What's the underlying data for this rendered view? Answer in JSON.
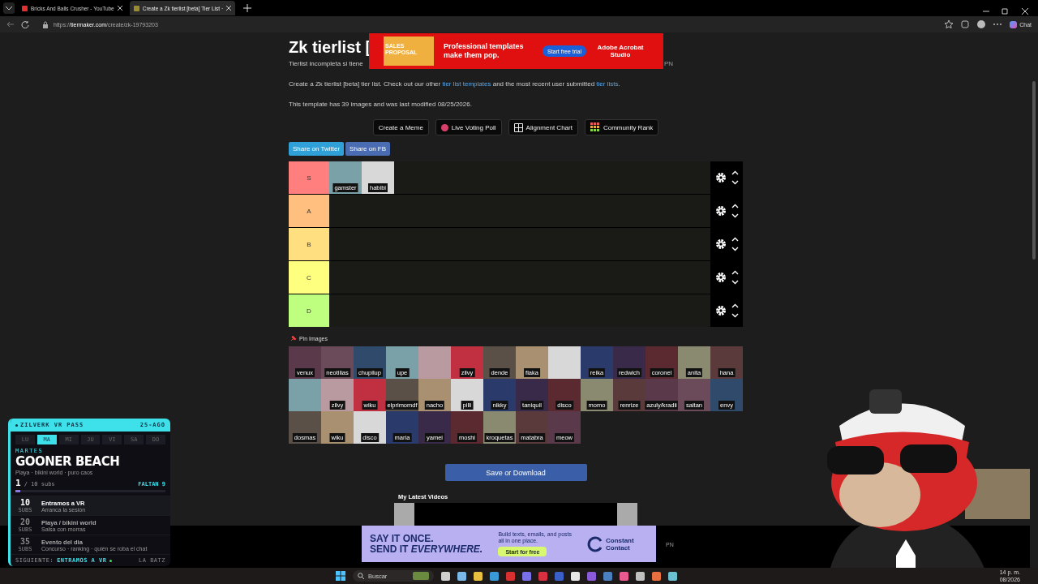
{
  "browser": {
    "tabs": [
      {
        "title": "Bricks And Balls Crusher - YouTube",
        "selected": false
      },
      {
        "title": "Create a Zk tierlist [beta] Tier List ·",
        "selected": true
      }
    ],
    "url": {
      "scheme": "https://",
      "host": "tiermaker.com",
      "path": "/create/zk-19793203"
    },
    "chat_label": "Chat"
  },
  "page": {
    "title": "Zk tierlist [",
    "description": "Tierlist incompleta si tiene",
    "side_text": "PN",
    "intro": [
      {
        "kind": "text",
        "text": "Create a Zk tierlist [beta] tier list. Check out our other "
      },
      {
        "kind": "link",
        "text": "tier list templates"
      },
      {
        "kind": "text",
        "text": " and the most recent user submitted "
      },
      {
        "kind": "link",
        "text": "tier lists"
      },
      {
        "kind": "text",
        "text": "."
      }
    ],
    "template_info": "This template has 39 images and was last modified 08/25/2026.",
    "tool_buttons": [
      {
        "label": "Create a Meme",
        "kind": "plain"
      },
      {
        "label": "Live Voting Poll",
        "kind": "dot"
      },
      {
        "label": "Alignment Chart",
        "kind": "grid"
      },
      {
        "label": "Community Rank",
        "kind": "mosaic"
      }
    ],
    "share_buttons": [
      {
        "label": "Share on Twitter",
        "color": "#2fa0d8"
      },
      {
        "label": "Share on FB",
        "color": "#4a6cb3"
      }
    ],
    "tiers": [
      {
        "label": "S",
        "color": "#ff7f7f",
        "items": [
          {
            "label": "gamster"
          },
          {
            "label": "habibi"
          }
        ]
      },
      {
        "label": "A",
        "color": "#ffbf7f"
      },
      {
        "label": "B",
        "color": "#ffdf7f"
      },
      {
        "label": "C",
        "color": "#ffff7f"
      },
      {
        "label": "D",
        "color": "#bfff7f"
      }
    ],
    "pin_label": "Pin Images",
    "images": [
      {
        "label": "venux"
      },
      {
        "label": "neotilias"
      },
      {
        "label": "chupilup"
      },
      {
        "label": "upe"
      },
      {
        "captioned": false
      },
      {
        "label": "zilvy"
      },
      {
        "label": "dende"
      },
      {
        "label": "flaka"
      },
      {
        "captioned": false
      },
      {
        "label": "reika"
      },
      {
        "label": "redwich"
      },
      {
        "label": "coronel"
      },
      {
        "label": "anita"
      },
      {
        "label": "hana"
      },
      {
        "captioned": false
      },
      {
        "label": "zilvy"
      },
      {
        "label": "wiku"
      },
      {
        "label": "elprimomdf"
      },
      {
        "label": "nacho"
      },
      {
        "label": "pilli"
      },
      {
        "label": "nikky"
      },
      {
        "label": "taniquil"
      },
      {
        "label": "disco"
      },
      {
        "label": "momo"
      },
      {
        "label": "renrize"
      },
      {
        "label": "azuly/kradii"
      },
      {
        "label": "saitan"
      },
      {
        "label": "envy"
      },
      {
        "label": "dosmas"
      },
      {
        "label": "wiku"
      },
      {
        "label": "disco"
      },
      {
        "label": "maria"
      },
      {
        "label": "yamei"
      },
      {
        "label": "moshi"
      },
      {
        "label": "kroquetas"
      },
      {
        "label": "matabra"
      },
      {
        "label": "meow"
      }
    ],
    "save_button": "Save or Download",
    "latest_videos": "My Latest Videos"
  },
  "ads": {
    "top": {
      "product_text": "SALES PROPOSAL",
      "headline": "Professional templates make them pop.",
      "cta": "Start free trial",
      "brand": "Adobe Acrobat Studio"
    },
    "bottom": {
      "headline_1": "SAY IT ONCE.",
      "headline_2": "SEND IT *EVERYWHERE.*",
      "body": "Build texts, emails, and posts all in one place.",
      "cta": "Start for free",
      "brand": "Constant Contact",
      "side_text": "PN"
    }
  },
  "overlay": {
    "title": "ZILVERK VR PASS",
    "date": "25-AGO",
    "days": [
      {
        "label": "LU",
        "selected": false
      },
      {
        "label": "MA",
        "selected": true
      },
      {
        "label": "MI",
        "selected": false
      },
      {
        "label": "JU",
        "selected": false
      },
      {
        "label": "VI",
        "selected": false
      },
      {
        "label": "SA",
        "selected": false
      },
      {
        "label": "DO",
        "selected": false
      }
    ],
    "day_name": "MARTES",
    "event": "GOONER BEACH",
    "subtitle": "Playa · bikini world · puro caos",
    "count": "1",
    "goal": "/ 10 subs",
    "remaining": "FALTAN 9",
    "level": 0.03,
    "milestones": [
      {
        "subs": "10",
        "unit": "SUBS",
        "title": "Entramos a VR",
        "desc": "Arranca la sesión",
        "active": true
      },
      {
        "subs": "20",
        "unit": "SUBS",
        "title": "Playa / bikini world",
        "desc": "Salsa con morras",
        "active": false
      },
      {
        "subs": "35",
        "unit": "SUBS",
        "title": "Evento del dia",
        "desc": "Concurso · ranking · quién se roba el chat",
        "active": false
      }
    ],
    "next_label": "SIGUIENTE:",
    "next_value": "ENTRAMOS A VR",
    "footer_right": "LA BATZ"
  },
  "taskbar": {
    "search": "Buscar",
    "time": "14 p. m.",
    "date": "08/2026"
  }
}
